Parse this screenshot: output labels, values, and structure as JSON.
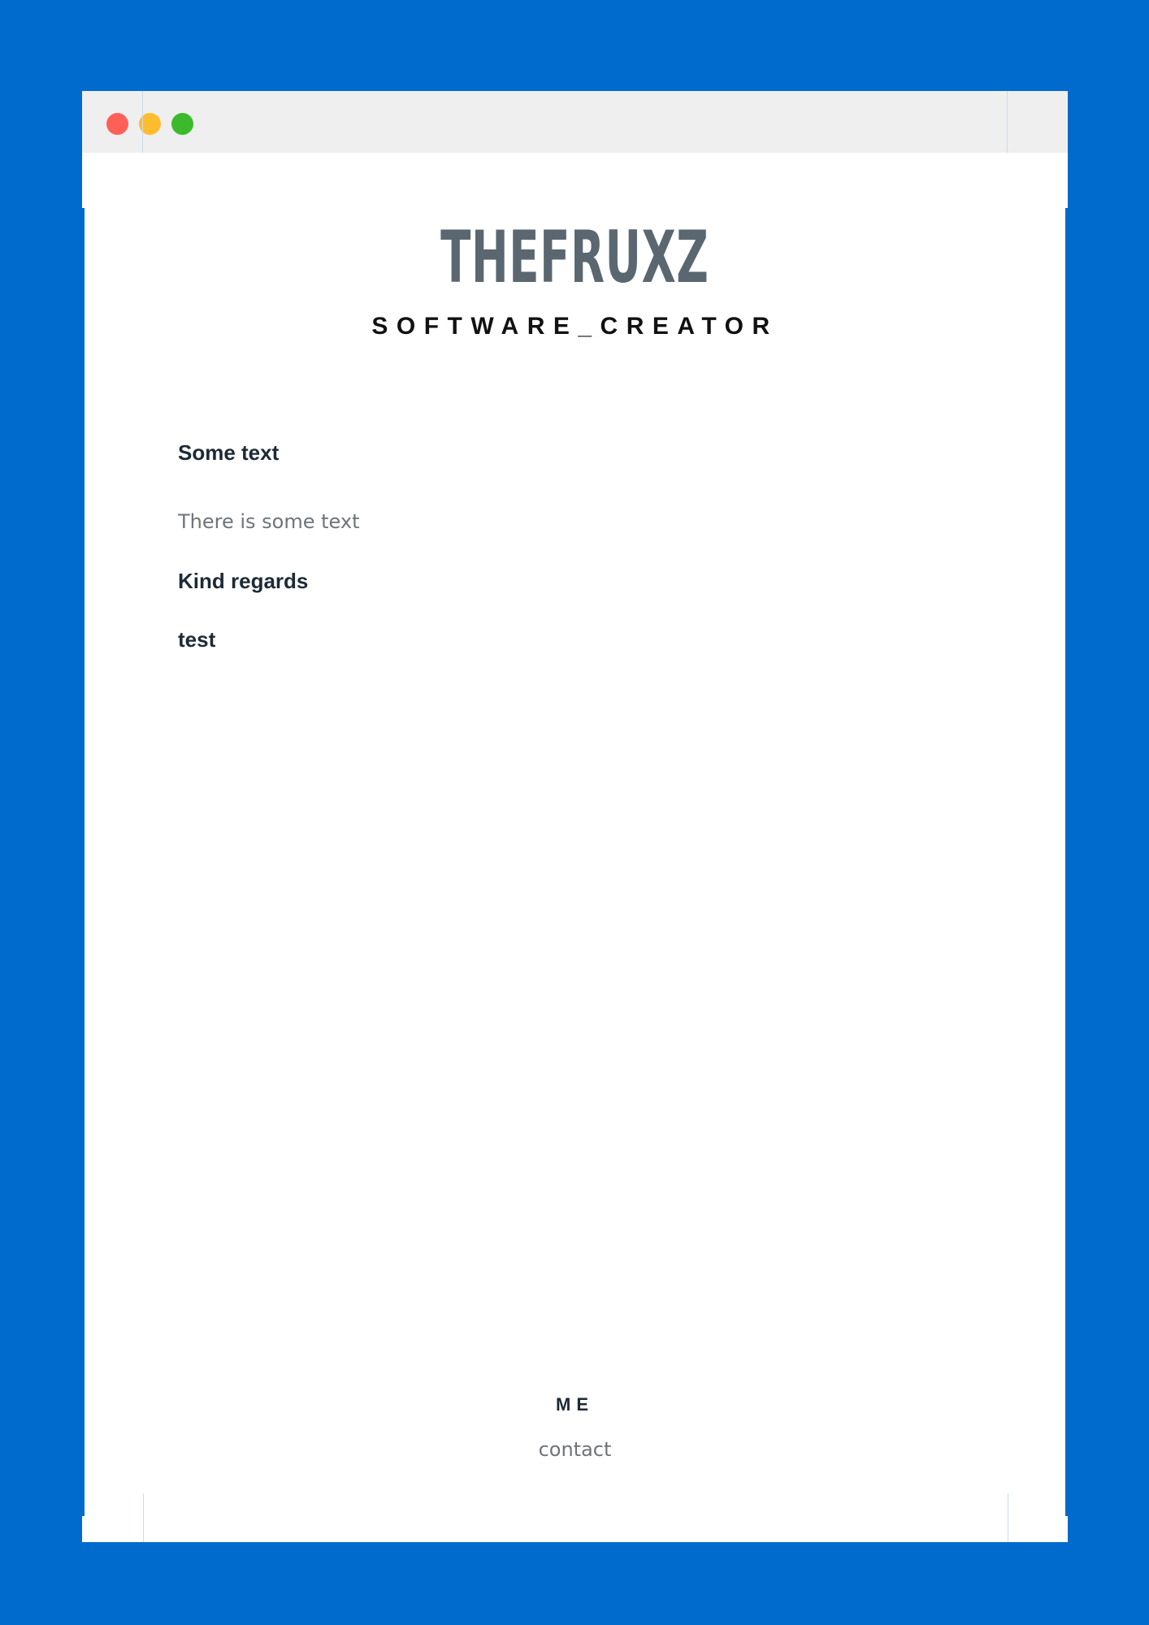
{
  "colors": {
    "background": "#006bcc",
    "window": "#ffffff",
    "titlebar": "#efefef",
    "close_dot": "#fe5f57",
    "minimize_dot": "#febc2e",
    "maximize_dot": "#3cba2c",
    "title_text": "#5b6770",
    "heading_text": "#1e2a35",
    "body_text": "#6f7478"
  },
  "window_controls": {
    "close_icon": "close-dot-icon",
    "minimize_icon": "minimize-dot-icon",
    "maximize_icon": "maximize-dot-icon"
  },
  "header": {
    "title": "THEFRUXZ",
    "subtitle": "SOFTWARE_CREATOR"
  },
  "main": {
    "heading": "Some text",
    "body": "There is some text",
    "regards": "Kind regards",
    "signature": "test"
  },
  "footer": {
    "section_title": "ME",
    "contact_link": "contact"
  }
}
